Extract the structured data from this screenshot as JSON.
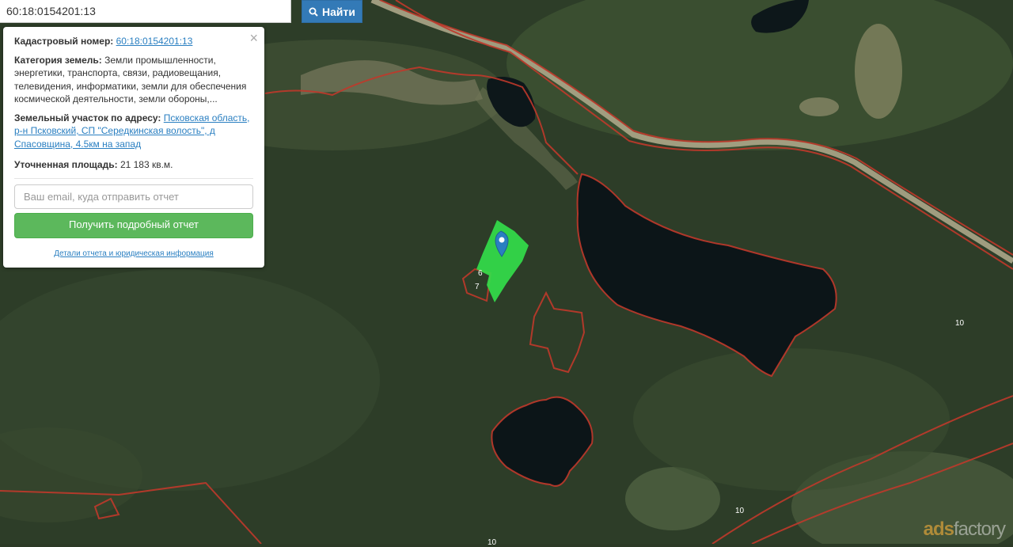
{
  "search": {
    "value": "60:18:0154201:13",
    "button_label": "Найти",
    "button_icon": "search-icon"
  },
  "popup": {
    "cadastral_label": "Кадастровый номер:",
    "cadastral_value": "60:18:0154201:13",
    "category_label": "Категория земель:",
    "category_value": "Земли промышленности, энергетики, транспорта, связи, радиовещания, телевидения, информатики, земли для обеспечения космической деятельности, земли обороны,...",
    "address_label": "Земельный участок по адресу:",
    "address_value": "Псковская область, р-н Псковский, СП \"Середкинская волость\", д Спасовщина, 4.5км на запад",
    "area_label": "Уточненная площадь:",
    "area_value": "21 183 кв.м.",
    "email_placeholder": "Ваш email, куда отправить отчет",
    "report_button": "Получить подробный отчет",
    "details_link": "Детали отчета и юридическая информация",
    "close_icon": "close-icon"
  },
  "map": {
    "parcel_numbers": [
      "6",
      "7",
      "10",
      "10",
      "10"
    ],
    "colors": {
      "parcel_fill": "#33e04a",
      "boundary": "#c0392b",
      "marker": "#2a7fc1",
      "water": "#0b1416"
    }
  },
  "watermark": {
    "ads": "ads",
    "factory": "factory"
  }
}
